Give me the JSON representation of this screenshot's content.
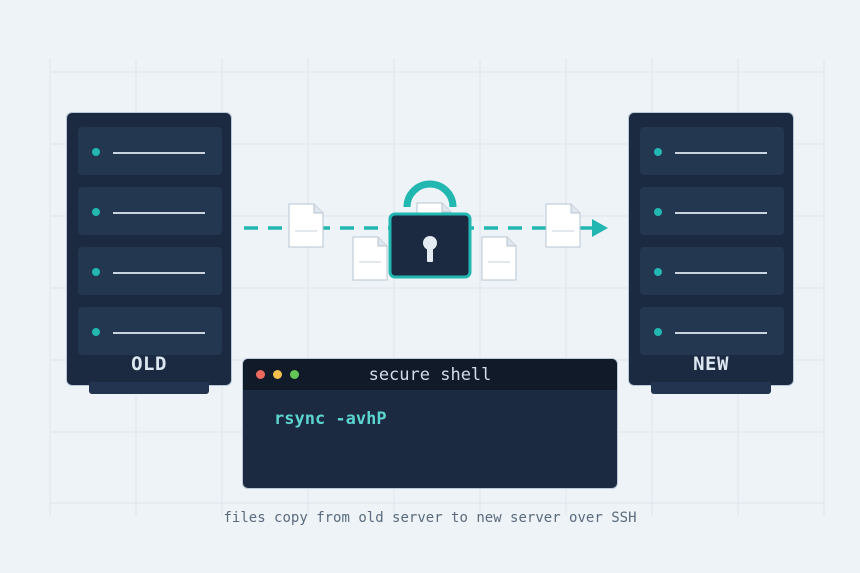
{
  "servers": {
    "old": {
      "label": "OLD",
      "units": 4
    },
    "new": {
      "label": "NEW",
      "units": 4
    }
  },
  "transfer": {
    "lock_icon": "padlock-icon",
    "document_icon": "document-icon",
    "arrow": "dashed-arrow-right"
  },
  "terminal": {
    "title": "secure shell",
    "command": "rsync -avhP",
    "window_controls": [
      "close",
      "minimize",
      "maximize"
    ]
  },
  "caption": "files copy from old server to new server over SSH",
  "colors": {
    "background": "#eef3f7",
    "server_body": "#1b2a41",
    "server_unit": "#233750",
    "accent_teal": "#23b7b1",
    "terminal_text": "#5cd4cf",
    "dot_red": "#ee6a5f",
    "dot_yellow": "#f5be4f",
    "dot_green": "#62c554"
  }
}
